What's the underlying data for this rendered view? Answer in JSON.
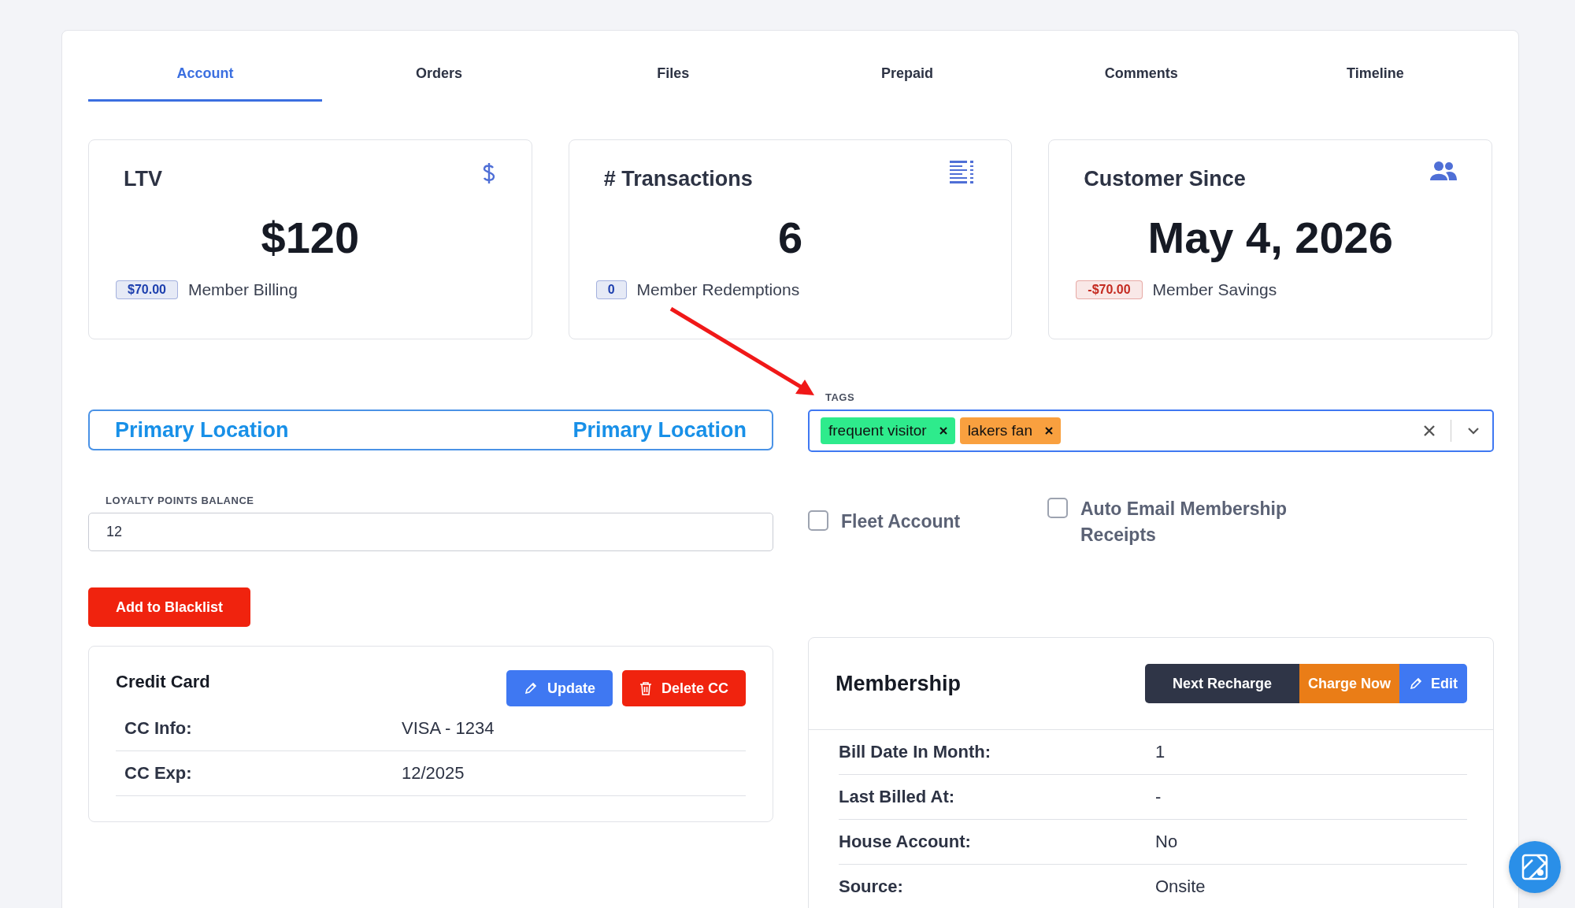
{
  "tabs": [
    {
      "label": "Account",
      "selected": true
    },
    {
      "label": "Orders",
      "selected": false
    },
    {
      "label": "Files",
      "selected": false
    },
    {
      "label": "Prepaid",
      "selected": false
    },
    {
      "label": "Comments",
      "selected": false
    },
    {
      "label": "Timeline",
      "selected": false
    }
  ],
  "stats": [
    {
      "title": "LTV",
      "value": "$120",
      "badge": "$70.00",
      "color": "#1d3fae",
      "caption": "Member Billing"
    },
    {
      "title": "# Transactions",
      "value": "6",
      "badge": "0",
      "color": "#1d3fae",
      "caption": "Member Redemptions"
    },
    {
      "title": "Customer Since",
      "value": "May 4, 2026",
      "badge": "-$70.00",
      "color": "#c42a20",
      "caption": "Member Savings"
    }
  ],
  "location": {
    "left": "Primary Location",
    "right": "Primary Location"
  },
  "tags": {
    "label": "TAGS",
    "items": [
      {
        "label": "frequent visitor",
        "color": "#2eeb8c"
      },
      {
        "label": "lakers fan",
        "color": "#f9a03f"
      }
    ]
  },
  "loyalty": {
    "label": "LOYALTY POINTS BALANCE",
    "value": "12"
  },
  "checkboxes": [
    {
      "label": "Fleet Account",
      "checked": false
    },
    {
      "label": "Auto Email Membership Receipts",
      "checked": false
    }
  ],
  "blacklist_button": "Add to Blacklist",
  "credit_card": {
    "title": "Credit Card",
    "buttons": [
      {
        "label": "Update",
        "kind": "update"
      },
      {
        "label": "Delete CC",
        "kind": "delete"
      }
    ],
    "rows": [
      {
        "label": "CC Info:",
        "value": "VISA - 1234"
      },
      {
        "label": "CC Exp:",
        "value": "12/2025"
      }
    ]
  },
  "membership": {
    "title": "Membership",
    "buttons": [
      {
        "label": "Next Recharge",
        "kind": "dark"
      },
      {
        "label": "Charge Now",
        "kind": "orange"
      },
      {
        "label": "Edit",
        "kind": "edit"
      }
    ],
    "rows": [
      {
        "label": "Bill Date In Month:",
        "value": "1"
      },
      {
        "label": "Last Billed At:",
        "value": "-"
      },
      {
        "label": "House Account:",
        "value": "No"
      },
      {
        "label": "Source:",
        "value": "Onsite"
      }
    ]
  }
}
